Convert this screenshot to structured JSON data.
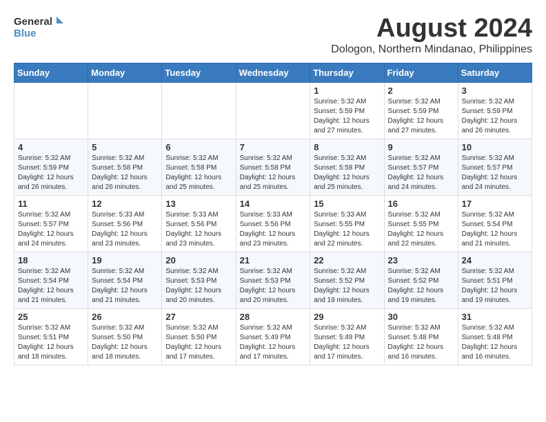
{
  "logo": {
    "line1": "General",
    "line2": "Blue"
  },
  "title": "August 2024",
  "subtitle": "Dologon, Northern Mindanao, Philippines",
  "days_of_week": [
    "Sunday",
    "Monday",
    "Tuesday",
    "Wednesday",
    "Thursday",
    "Friday",
    "Saturday"
  ],
  "weeks": [
    [
      {
        "day": "",
        "info": ""
      },
      {
        "day": "",
        "info": ""
      },
      {
        "day": "",
        "info": ""
      },
      {
        "day": "",
        "info": ""
      },
      {
        "day": "1",
        "info": "Sunrise: 5:32 AM\nSunset: 5:59 PM\nDaylight: 12 hours\nand 27 minutes."
      },
      {
        "day": "2",
        "info": "Sunrise: 5:32 AM\nSunset: 5:59 PM\nDaylight: 12 hours\nand 27 minutes."
      },
      {
        "day": "3",
        "info": "Sunrise: 5:32 AM\nSunset: 5:59 PM\nDaylight: 12 hours\nand 26 minutes."
      }
    ],
    [
      {
        "day": "4",
        "info": "Sunrise: 5:32 AM\nSunset: 5:59 PM\nDaylight: 12 hours\nand 26 minutes."
      },
      {
        "day": "5",
        "info": "Sunrise: 5:32 AM\nSunset: 5:58 PM\nDaylight: 12 hours\nand 26 minutes."
      },
      {
        "day": "6",
        "info": "Sunrise: 5:32 AM\nSunset: 5:58 PM\nDaylight: 12 hours\nand 25 minutes."
      },
      {
        "day": "7",
        "info": "Sunrise: 5:32 AM\nSunset: 5:58 PM\nDaylight: 12 hours\nand 25 minutes."
      },
      {
        "day": "8",
        "info": "Sunrise: 5:32 AM\nSunset: 5:58 PM\nDaylight: 12 hours\nand 25 minutes."
      },
      {
        "day": "9",
        "info": "Sunrise: 5:32 AM\nSunset: 5:57 PM\nDaylight: 12 hours\nand 24 minutes."
      },
      {
        "day": "10",
        "info": "Sunrise: 5:32 AM\nSunset: 5:57 PM\nDaylight: 12 hours\nand 24 minutes."
      }
    ],
    [
      {
        "day": "11",
        "info": "Sunrise: 5:32 AM\nSunset: 5:57 PM\nDaylight: 12 hours\nand 24 minutes."
      },
      {
        "day": "12",
        "info": "Sunrise: 5:33 AM\nSunset: 5:56 PM\nDaylight: 12 hours\nand 23 minutes."
      },
      {
        "day": "13",
        "info": "Sunrise: 5:33 AM\nSunset: 5:56 PM\nDaylight: 12 hours\nand 23 minutes."
      },
      {
        "day": "14",
        "info": "Sunrise: 5:33 AM\nSunset: 5:56 PM\nDaylight: 12 hours\nand 23 minutes."
      },
      {
        "day": "15",
        "info": "Sunrise: 5:33 AM\nSunset: 5:55 PM\nDaylight: 12 hours\nand 22 minutes."
      },
      {
        "day": "16",
        "info": "Sunrise: 5:32 AM\nSunset: 5:55 PM\nDaylight: 12 hours\nand 22 minutes."
      },
      {
        "day": "17",
        "info": "Sunrise: 5:32 AM\nSunset: 5:54 PM\nDaylight: 12 hours\nand 21 minutes."
      }
    ],
    [
      {
        "day": "18",
        "info": "Sunrise: 5:32 AM\nSunset: 5:54 PM\nDaylight: 12 hours\nand 21 minutes."
      },
      {
        "day": "19",
        "info": "Sunrise: 5:32 AM\nSunset: 5:54 PM\nDaylight: 12 hours\nand 21 minutes."
      },
      {
        "day": "20",
        "info": "Sunrise: 5:32 AM\nSunset: 5:53 PM\nDaylight: 12 hours\nand 20 minutes."
      },
      {
        "day": "21",
        "info": "Sunrise: 5:32 AM\nSunset: 5:53 PM\nDaylight: 12 hours\nand 20 minutes."
      },
      {
        "day": "22",
        "info": "Sunrise: 5:32 AM\nSunset: 5:52 PM\nDaylight: 12 hours\nand 19 minutes."
      },
      {
        "day": "23",
        "info": "Sunrise: 5:32 AM\nSunset: 5:52 PM\nDaylight: 12 hours\nand 19 minutes."
      },
      {
        "day": "24",
        "info": "Sunrise: 5:32 AM\nSunset: 5:51 PM\nDaylight: 12 hours\nand 19 minutes."
      }
    ],
    [
      {
        "day": "25",
        "info": "Sunrise: 5:32 AM\nSunset: 5:51 PM\nDaylight: 12 hours\nand 18 minutes."
      },
      {
        "day": "26",
        "info": "Sunrise: 5:32 AM\nSunset: 5:50 PM\nDaylight: 12 hours\nand 18 minutes."
      },
      {
        "day": "27",
        "info": "Sunrise: 5:32 AM\nSunset: 5:50 PM\nDaylight: 12 hours\nand 17 minutes."
      },
      {
        "day": "28",
        "info": "Sunrise: 5:32 AM\nSunset: 5:49 PM\nDaylight: 12 hours\nand 17 minutes."
      },
      {
        "day": "29",
        "info": "Sunrise: 5:32 AM\nSunset: 5:49 PM\nDaylight: 12 hours\nand 17 minutes."
      },
      {
        "day": "30",
        "info": "Sunrise: 5:32 AM\nSunset: 5:48 PM\nDaylight: 12 hours\nand 16 minutes."
      },
      {
        "day": "31",
        "info": "Sunrise: 5:32 AM\nSunset: 5:48 PM\nDaylight: 12 hours\nand 16 minutes."
      }
    ]
  ]
}
